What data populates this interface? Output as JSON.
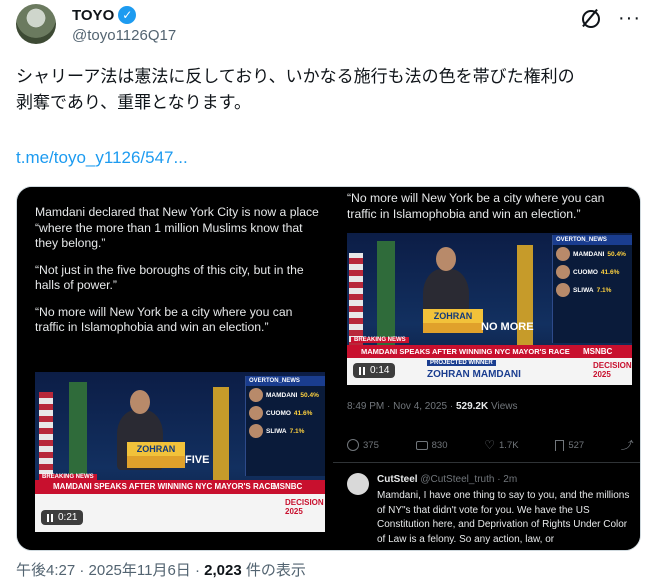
{
  "author": {
    "name": "TOYO",
    "handle": "@toyo1126Q17"
  },
  "tweet": {
    "text_line1": "シャリーア法は憲法に反しており、いかなる施行も法の色を帯びた権利の",
    "text_line2": "剥奪であり、重罪となります。",
    "link": "t.me/toyo_y1126/547..."
  },
  "left_panel": {
    "paragraph1": "Mamdani declared that New York City is now a place “where the more than 1 million Muslims know that they belong.”",
    "paragraph2": "“Not just in the five boroughs of this city, but in the halls of power.”",
    "paragraph3": "“No more will New York be a city where you can traffic in Islamophobia and win an election.”",
    "video": {
      "podium_text": "ZOHRAN",
      "overlay_word": "FIVE",
      "headline": "MAMDANI SPEAKS AFTER WINNING NYC MAYOR'S RACE",
      "breaking": "BREAKING NEWS",
      "network": "MSNBC",
      "time": "0:21",
      "decision": "DECISION 2025",
      "results": [
        {
          "name": "MAMDANI",
          "pct": "50.4%"
        },
        {
          "name": "CUOMO",
          "pct": "41.6%"
        },
        {
          "name": "SLIWA",
          "pct": "7.1%"
        }
      ]
    }
  },
  "right_panel": {
    "quote": "“No more will New York be a city where you can traffic in Islamophobia and win an election.”",
    "video": {
      "podium_text": "ZOHRAN",
      "overlay_word": "NO MORE",
      "headline": "MAMDANI SPEAKS AFTER WINNING NYC MAYOR'S RACE",
      "breaking": "BREAKING NEWS",
      "network": "MSNBC",
      "time": "0:14",
      "projected": "PROJECTED WINNER",
      "winner": "ZOHRAN MAMDANI",
      "decision": "DECISION 2025",
      "results": [
        {
          "name": "MAMDANI",
          "pct": "50.4%"
        },
        {
          "name": "CUOMO",
          "pct": "41.6%"
        },
        {
          "name": "SLIWA",
          "pct": "7.1%"
        }
      ]
    },
    "meta_time": "8:49 PM · Nov 4, 2025 · ",
    "meta_views": "529.2K",
    "meta_views_label": " Views",
    "actions": {
      "replies": "375",
      "reposts": "830",
      "likes": "1.7K",
      "bookmarks": "527"
    },
    "reply": {
      "name": "CutSteel",
      "handle": "@CutSteel_truth · 2m",
      "text": "Mamdani, I have one thing to say to you, and the millions of NY\"s that didn't vote for you. We have the US Constitution here, and Deprivation of Rights Under Color of Law is a felony. So any action, law, or"
    }
  },
  "footer": {
    "datetime": "午後4:27 · 2025年11月6日 · ",
    "views": "2,023",
    "views_label": " 件の表示"
  }
}
